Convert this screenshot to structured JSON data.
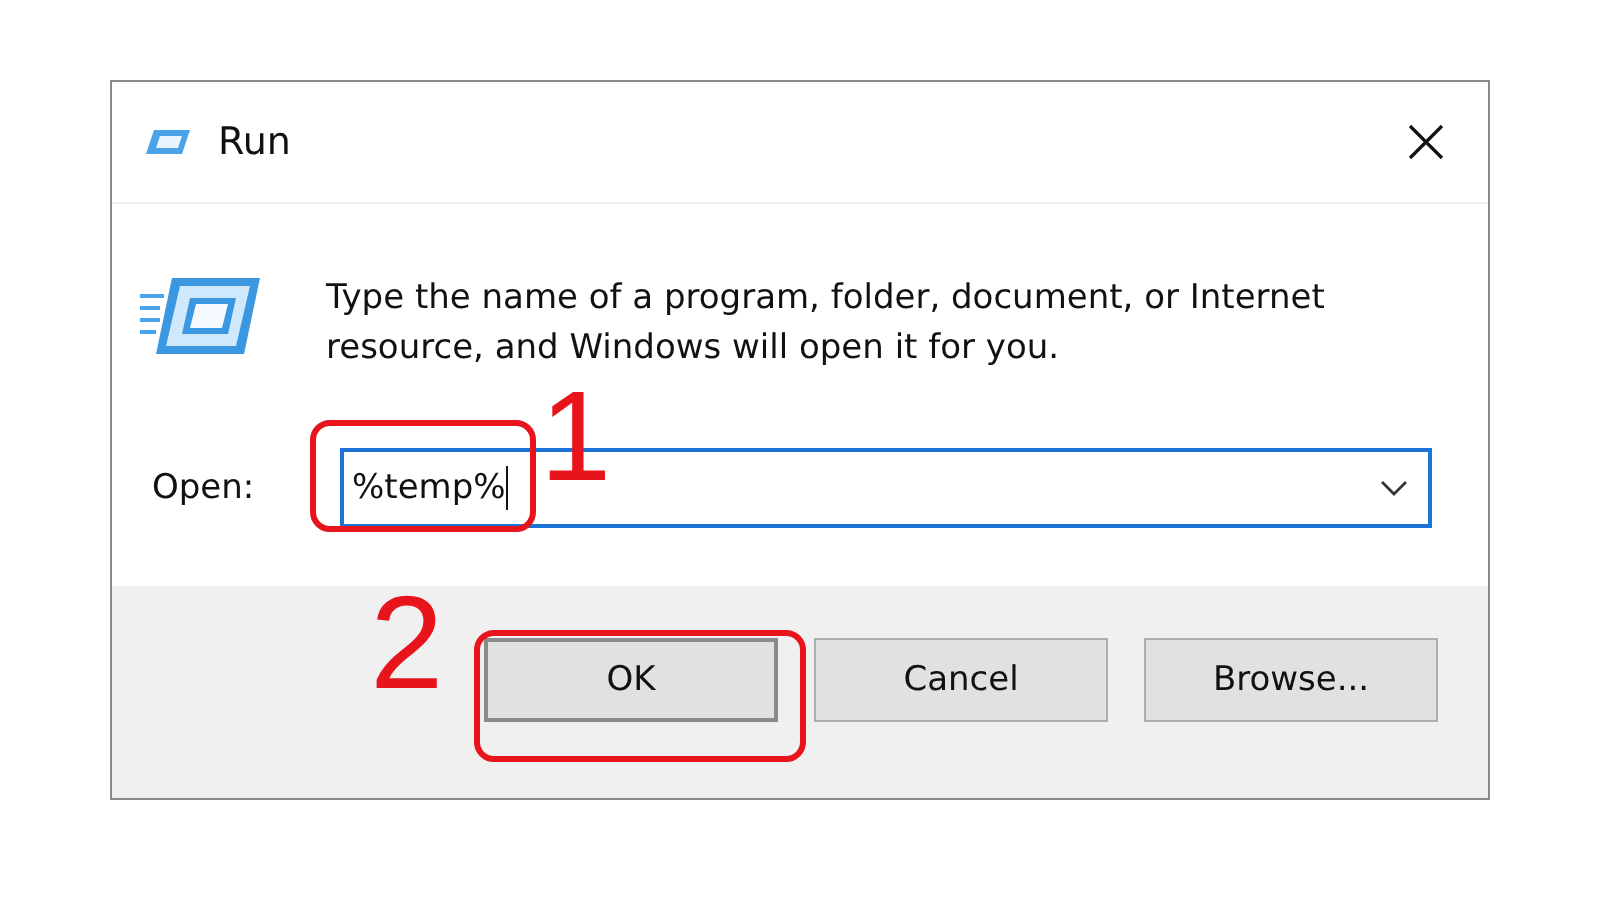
{
  "window": {
    "title": "Run"
  },
  "message": "Type the name of a program, folder, document, or Internet resource, and Windows will open it for you.",
  "open_label": "Open:",
  "command_field": {
    "value": "%temp%"
  },
  "buttons": [
    {
      "label": "OK",
      "highlighted": true
    },
    {
      "label": "Cancel",
      "highlighted": false
    },
    {
      "label": "Browse...",
      "highlighted": false
    }
  ],
  "annotations": [
    {
      "text": "1"
    },
    {
      "text": "2"
    }
  ]
}
